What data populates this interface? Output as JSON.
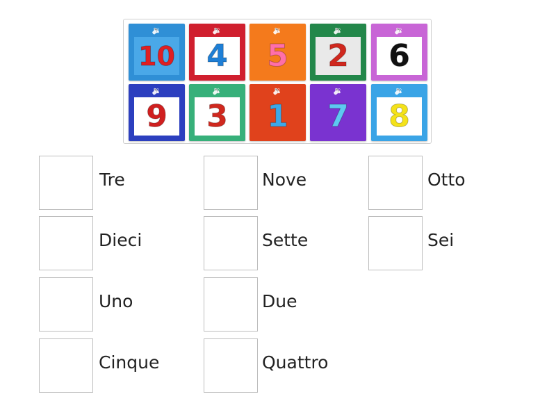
{
  "tiles": [
    {
      "number": "10",
      "icon": "speaker-icon",
      "tile_color": "#2f8fd6",
      "card_bg": "#4aa8e8",
      "digit_color": "#e01e22"
    },
    {
      "number": "4",
      "icon": "speaker-icon",
      "tile_color": "#d01f2e",
      "card_bg": "#ffffff",
      "digit_color": "#1e7fd6"
    },
    {
      "number": "5",
      "icon": "speaker-icon",
      "tile_color": "#f47a1c",
      "card_bg": "#f47a1c",
      "digit_color": "#ff6fa8"
    },
    {
      "number": "2",
      "icon": "speaker-icon",
      "tile_color": "#23874a",
      "card_bg": "#e9e9e9",
      "digit_color": "#d0281e"
    },
    {
      "number": "6",
      "icon": "speaker-icon",
      "tile_color": "#c865d6",
      "card_bg": "#ffffff",
      "digit_color": "#111111"
    },
    {
      "number": "9",
      "icon": "speaker-icon",
      "tile_color": "#2c3fbf",
      "card_bg": "#ffffff",
      "digit_color": "#d01f1f"
    },
    {
      "number": "3",
      "icon": "speaker-icon",
      "tile_color": "#37b07a",
      "card_bg": "#ffffff",
      "digit_color": "#d0281e"
    },
    {
      "number": "1",
      "icon": "speaker-icon",
      "tile_color": "#e0421c",
      "card_bg": "#e0421c",
      "digit_color": "#3da8e8"
    },
    {
      "number": "7",
      "icon": "speaker-icon",
      "tile_color": "#7a33d0",
      "card_bg": "#7a33d0",
      "digit_color": "#5ec8f2"
    },
    {
      "number": "8",
      "icon": "speaker-icon",
      "tile_color": "#3aa4e6",
      "card_bg": "#ffffff",
      "digit_color": "#f4e21a"
    }
  ],
  "targets": [
    {
      "label": "Tre"
    },
    {
      "label": "Nove"
    },
    {
      "label": "Otto"
    },
    {
      "label": "Dieci"
    },
    {
      "label": "Sette"
    },
    {
      "label": "Sei"
    },
    {
      "label": "Uno"
    },
    {
      "label": "Due"
    },
    {
      "label": "Cinque"
    },
    {
      "label": "Quattro"
    }
  ]
}
